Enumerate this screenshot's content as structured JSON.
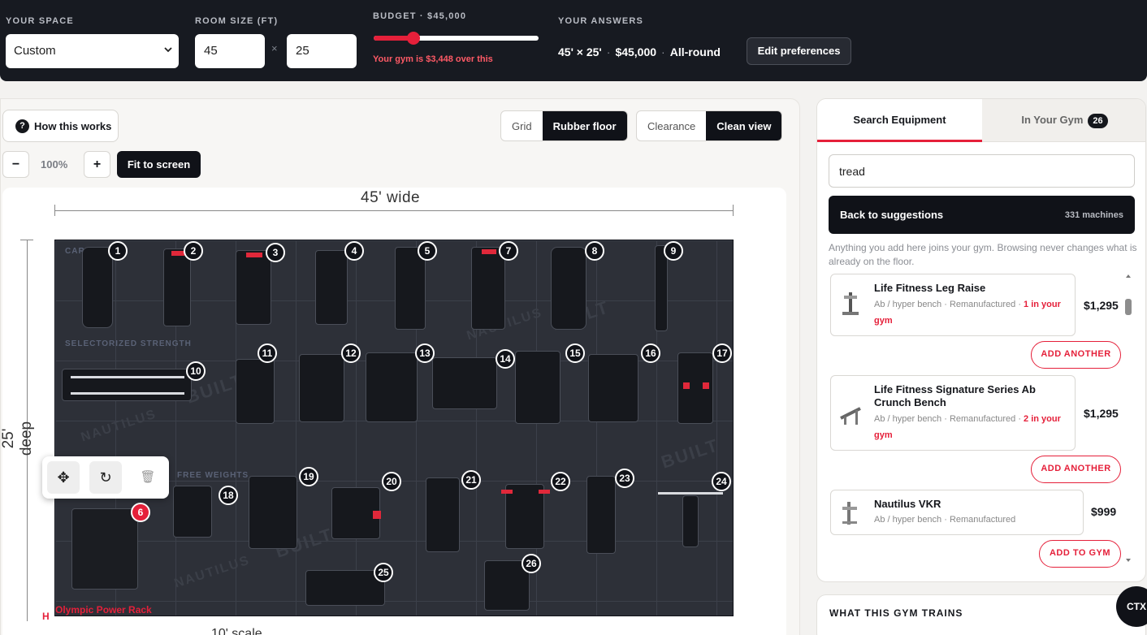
{
  "topbar": {
    "space_label": "YOUR SPACE",
    "space_value": "Custom",
    "room_label": "ROOM SIZE (FT)",
    "width": "45",
    "depth": "25",
    "times": "×",
    "budget_label": "BUDGET · $45,000",
    "budget_fill_fraction": 0.24,
    "over_text": "Your gym is $3,448 over this",
    "answers_label": "YOUR ANSWERS",
    "answer_size": "45' × 25'",
    "answer_budget": "$45,000",
    "answer_focus": "All-round",
    "dot": "·",
    "edit_label": "Edit preferences"
  },
  "toolbar": {
    "how_label": "How this works",
    "how_icon": "?",
    "grid_label": "Grid",
    "rubber_label": "Rubber floor",
    "clearance_label": "Clearance",
    "clean_label": "Clean view",
    "zoom_out": "−",
    "zoom_value": "100%",
    "zoom_in": "+",
    "fit_label": "Fit to screen"
  },
  "canvas": {
    "width_label": "45' wide",
    "depth_label": "25' deep",
    "zone_cardio": "CARDIO",
    "zone_selectorized": "SELECTORIZED STRENGTH",
    "zone_free": "FREE WEIGHTS",
    "selected_label": "Olympic Power Rack",
    "ha_text": "H",
    "scale_label": "10' scale",
    "watermark_built": "BUILT",
    "watermark_nautilus": "NAUTILUS",
    "badges": [
      "1",
      "2",
      "3",
      "4",
      "5",
      "6",
      "7",
      "8",
      "9",
      "10",
      "11",
      "12",
      "13",
      "14",
      "15",
      "16",
      "17",
      "18",
      "19",
      "20",
      "21",
      "22",
      "23",
      "24",
      "25",
      "26"
    ]
  },
  "tools": {
    "move_icon": "✥",
    "rotate_icon": "↻",
    "delete_icon": "🗑"
  },
  "sidebar": {
    "tab_search": "Search Equipment",
    "tab_gym": "In Your Gym",
    "gym_count": "26",
    "search_value": "tread",
    "back_label": "Back to suggestions",
    "machines_count": "331 machines",
    "note": "Anything you add here joins your gym. Browsing never changes what is already on the floor.",
    "results": [
      {
        "name": "Life Fitness Leg Raise",
        "meta": "Ab / hyper bench · Remanufactured · ",
        "in_gym": "1 in your gym",
        "price": "$1,295",
        "action": "ADD ANOTHER"
      },
      {
        "name": "Life Fitness Signature Series Ab Crunch Bench",
        "meta": "Ab / hyper bench · Remanufactured · ",
        "in_gym": "2 in your gym",
        "price": "$1,295",
        "action": "ADD ANOTHER"
      },
      {
        "name": "Nautilus VKR",
        "meta": "Ab / hyper bench · Remanufactured",
        "in_gym": "",
        "price": "$999",
        "action": "ADD TO GYM"
      }
    ],
    "trains_label": "WHAT THIS GYM TRAINS",
    "ctx_label": "CTX"
  },
  "colors": {
    "accent": "#e5203a",
    "dark": "#101218",
    "floor": "#2d3038"
  }
}
